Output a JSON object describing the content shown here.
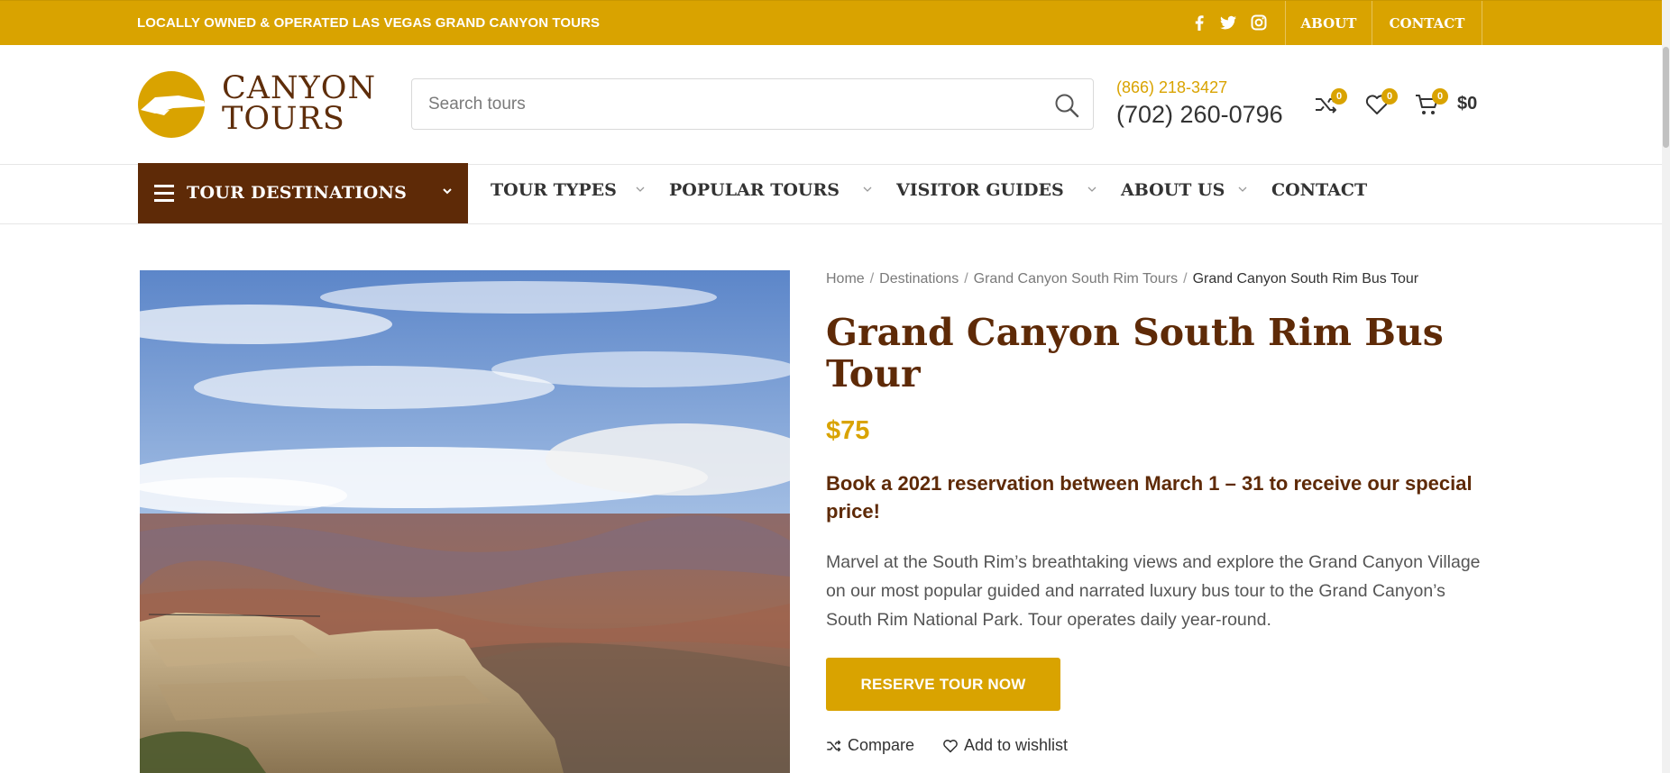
{
  "topbar": {
    "tagline": "LOCALLY OWNED & OPERATED LAS VEGAS GRAND CANYON TOURS",
    "social": [
      "facebook-icon",
      "twitter-icon",
      "instagram-icon"
    ],
    "links": [
      "ABOUT",
      "CONTACT"
    ]
  },
  "header": {
    "logo_line1": "CANYON",
    "logo_line2": "TOURS",
    "search_placeholder": "Search tours",
    "phone_primary": "(866) 218-3427",
    "phone_secondary": "(702) 260-0796",
    "compare_count": "0",
    "wishlist_count": "0",
    "cart_count": "0",
    "cart_total": "$0"
  },
  "nav": {
    "destinations_label": "TOUR DESTINATIONS",
    "items": [
      "TOUR TYPES",
      "POPULAR TOURS",
      "VISITOR GUIDES",
      "ABOUT US",
      "CONTACT"
    ]
  },
  "breadcrumb": [
    "Home",
    "Destinations",
    "Grand Canyon South Rim Tours",
    "Grand Canyon South Rim Bus Tour"
  ],
  "product": {
    "title": "Grand Canyon South Rim Bus Tour",
    "price": "$75",
    "promo": "Book a 2021 reservation between March 1 – 31 to receive our special price!",
    "description": "Marvel at the South Rim’s breathtaking views and explore the Grand Canyon Village on our most popular guided and narrated luxury bus tour to the Grand Canyon’s South Rim National Park. Tour operates daily year-round.",
    "reserve_label": "RESERVE TOUR NOW",
    "compare_label": "Compare",
    "wishlist_label": "Add to wishlist"
  },
  "colors": {
    "accent": "#d9a300",
    "brand_brown": "#5e2a07"
  }
}
